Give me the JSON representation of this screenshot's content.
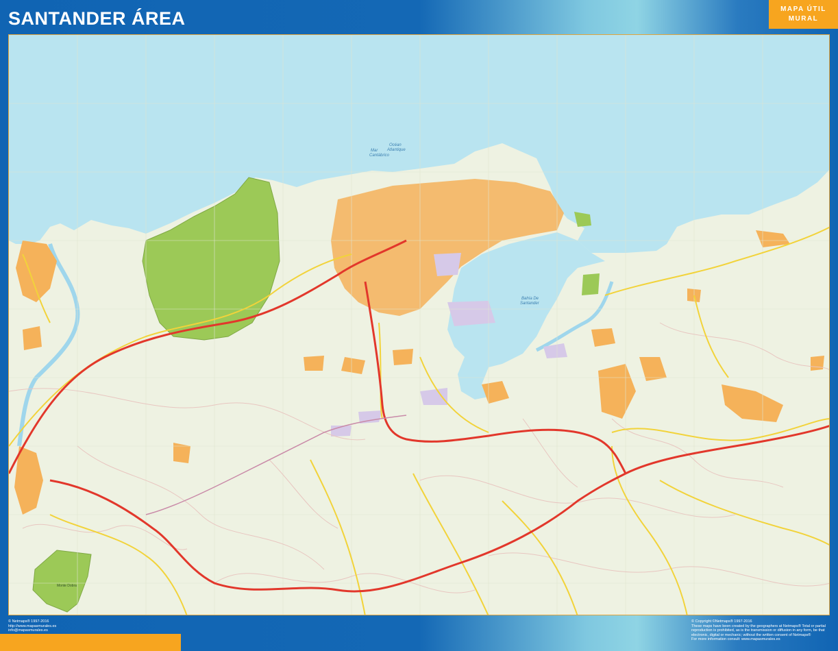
{
  "header": {
    "title": "SANTANDER ÁREA",
    "brand_line1": "MAPA ÚTIL",
    "brand_line2": "MURAL"
  },
  "map": {
    "labels": {
      "ocean_line1": "Océan",
      "ocean_line2": "Atlantique",
      "sea_line1": "Mar",
      "sea_line2": "Cantábrico",
      "bay_line1": "Bahía De",
      "bay_line2": "Santander",
      "park_label": "Monte Dobra"
    },
    "colors": {
      "sea": "#b9e4f0",
      "land": "#eef2e2",
      "urban": "#f5b25a",
      "park": "#9cc957",
      "highway": "#e2372b",
      "road": "#f2d33a"
    }
  },
  "footer": {
    "left": {
      "line1": "© Netmaps® 1997-2016",
      "line2": "http://www.mapasmurales.es",
      "line3": "info@mapasmurales.es"
    },
    "right": {
      "line1": "© Copyright ©Netmaps® 1997-2016",
      "line2": "These maps have been created by the geographers at Netmaps® Total or partial",
      "line3": "reproduction is prohibited, as is the transmission or diffusion in any form, be that",
      "line4": "electronic, digital or mechanic; without the written consent of Netmaps®",
      "line5": "For more information consult: www.mapasmurales.es"
    }
  }
}
